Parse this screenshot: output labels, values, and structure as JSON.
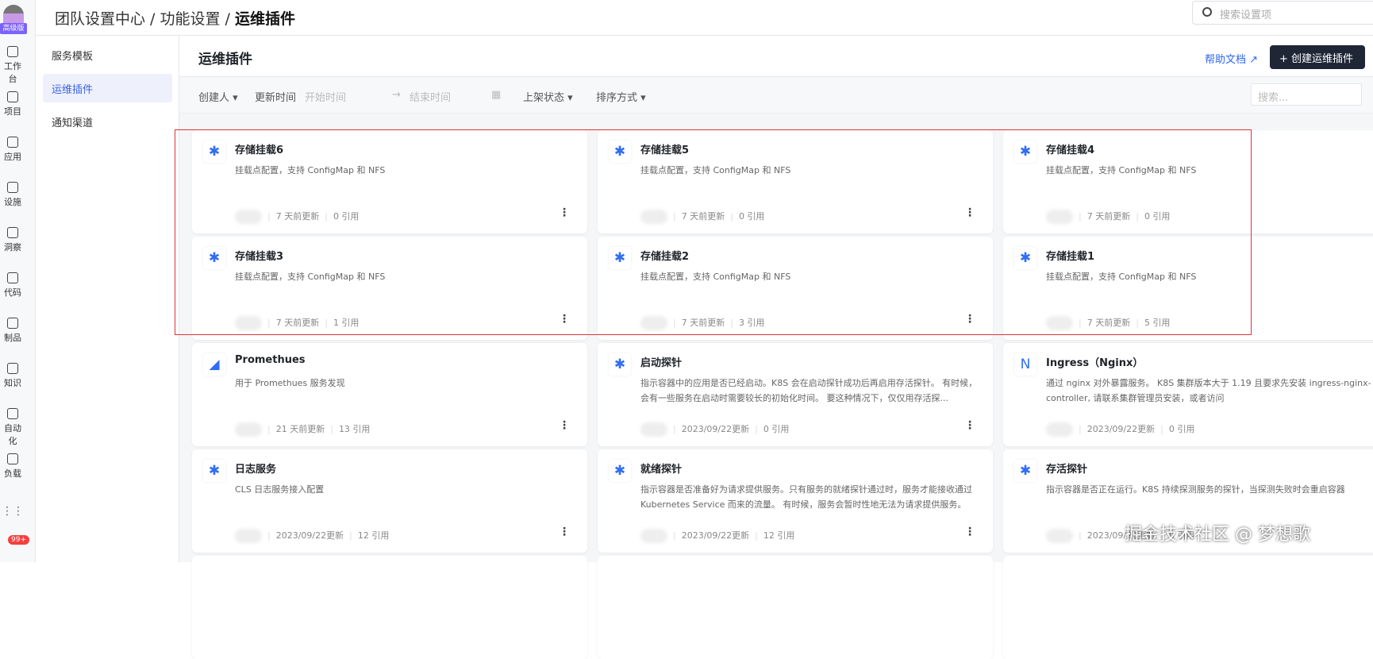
{
  "rail": {
    "badge": "高级版",
    "items": [
      "工作台",
      "项目",
      "应用",
      "设施",
      "洞察",
      "代码",
      "制品",
      "知识",
      "自动化",
      "负载"
    ],
    "notifications": "99+"
  },
  "topbar": {
    "crumb1": "团队设置中心 / 功能设置 / ",
    "crumb2": "运维插件",
    "search_placeholder": "搜索设置项"
  },
  "subnav": [
    "服务模板",
    "运维插件",
    "通知渠道"
  ],
  "page": {
    "title": "运维插件",
    "help": "帮助文档 ↗",
    "create": "+ 创建运维插件"
  },
  "filters": {
    "creator": "创建人 ▾",
    "updated": "更新时间",
    "start": "开始时间",
    "arrow": "→",
    "end": "结束时间",
    "cal": "▦",
    "status": "上架状态 ▾",
    "sort": "排序方式 ▾",
    "search": "搜索..."
  },
  "cards": [
    {
      "title": "存储挂载6",
      "desc": "挂载点配置，支持 ConfigMap 和 NFS",
      "time": "7 天前更新",
      "refs": "0 引用",
      "icon": "puzzle"
    },
    {
      "title": "存储挂载5",
      "desc": "挂载点配置，支持 ConfigMap 和 NFS",
      "time": "7 天前更新",
      "refs": "0 引用",
      "icon": "puzzle"
    },
    {
      "title": "存储挂载4",
      "desc": "挂载点配置，支持 ConfigMap 和 NFS",
      "time": "7 天前更新",
      "refs": "0 引用",
      "icon": "puzzle"
    },
    {
      "title": "存储挂载3",
      "desc": "挂载点配置，支持 ConfigMap 和 NFS",
      "time": "7 天前更新",
      "refs": "1 引用",
      "icon": "puzzle"
    },
    {
      "title": "存储挂载2",
      "desc": "挂载点配置，支持 ConfigMap 和 NFS",
      "time": "7 天前更新",
      "refs": "3 引用",
      "icon": "puzzle"
    },
    {
      "title": "存储挂载1",
      "desc": "挂载点配置，支持 ConfigMap 和 NFS",
      "time": "7 天前更新",
      "refs": "5 引用",
      "icon": "puzzle"
    },
    {
      "title": "Promethues",
      "desc": "用于 Promethues 服务发现",
      "time": "21 天前更新",
      "refs": "13 引用",
      "icon": "prometheus"
    },
    {
      "title": "启动探针",
      "desc": "指示容器中的应用是否已经启动。K8S 会在启动探针成功后再启用存活探针。 有时候，会有一些服务在启动时需要较长的初始化时间。 要这种情况下，仅仅用存活探...",
      "time": "2023/09/22更新",
      "refs": "0 引用",
      "icon": "puzzle"
    },
    {
      "title": "Ingress（Nginx）",
      "desc": "通过 nginx 对外暴露服务。 K8S 集群版本大于 1.19 且要求先安装 ingress-nginx-controller, 请联系集群管理员安装，或者访问 https://kubernetes.github.io/ingress-nginx/",
      "time": "2023/09/22更新",
      "refs": "0 引用",
      "icon": "nginx"
    },
    {
      "title": "日志服务",
      "desc": "CLS 日志服务接入配置",
      "time": "2023/09/22更新",
      "refs": "12 引用",
      "icon": "puzzle"
    },
    {
      "title": "就绪探针",
      "desc": "指示容器是否准备好为请求提供服务。只有服务的就绪探针通过时，服务才能接收通过 Kubernetes Service 而来的流量。 有时候，服务会暂时性地无法为请求提供服务。 例...",
      "time": "2023/09/22更新",
      "refs": "12 引用",
      "icon": "puzzle"
    },
    {
      "title": "存活探针",
      "desc": "指示容器是否正在运行。K8S 持续探测服务的探针，当探测失败时会重启容器",
      "time": "2023/09/22更新",
      "refs": "0 引用",
      "icon": "puzzle"
    }
  ],
  "watermark": "掘金技术社区 @ 梦想歌",
  "colors": {
    "accent": "#2f66f3",
    "highlight": "#e0333a"
  }
}
